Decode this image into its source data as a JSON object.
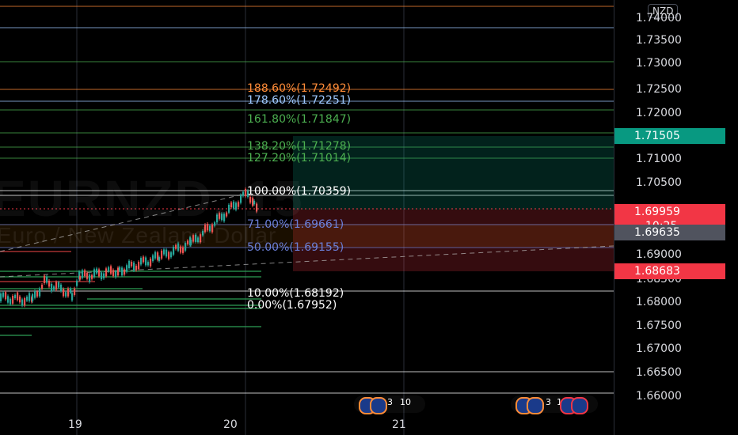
{
  "symbol_watermark": "EURNZD, 15",
  "name_watermark": "Euro / New Zealand Dollar",
  "currency": "NZD",
  "colors": {
    "up": "#26a69a",
    "down": "#ef5350",
    "price_label_green": "#089981",
    "price_label_red": "#f23645",
    "price_label_gray": "#50535e"
  },
  "price_axis": {
    "ticks": [
      "1.74000",
      "1.73500",
      "1.73000",
      "1.72500",
      "1.72000",
      "1.71000",
      "1.70500",
      "1.69000",
      "1.68500",
      "1.68000",
      "1.67500",
      "1.67000",
      "1.66500",
      "1.66000"
    ],
    "labels": [
      {
        "value": "1.71505",
        "color": "#089981"
      },
      {
        "value": "1.69959",
        "countdown": "10:25",
        "color": "#f23645"
      },
      {
        "value": "1.69635",
        "color": "#50535e"
      },
      {
        "value": "1.68683",
        "color": "#f23645"
      }
    ]
  },
  "fib_levels": [
    {
      "text": "188.60%(1.72492)",
      "color": "#ff8c38"
    },
    {
      "text": "178.60%(1.72251)",
      "color": "#9ec9ff"
    },
    {
      "text": "161.80%(1.71847)",
      "color": "#4caf50"
    },
    {
      "text": "138.20%(1.71278)",
      "color": "#4caf50"
    },
    {
      "text": "127.20%(1.71014)",
      "color": "#4caf50"
    },
    {
      "text": "100.00%(1.70359)",
      "color": "#ffffff"
    },
    {
      "text": "71.00%(1.69661)",
      "color": "#6b7fd7"
    },
    {
      "text": "50.00%(1.69155)",
      "color": "#6b7fd7"
    },
    {
      "text": "10.00%(1.68192)",
      "color": "#ffffff"
    },
    {
      "text": "0.00%(1.67952)",
      "color": "#ffffff"
    }
  ],
  "time_axis": [
    "19",
    "20",
    "21"
  ],
  "events": [
    {
      "label": "3",
      "extra": "10"
    },
    {
      "label": "3",
      "extra": "10"
    }
  ]
}
